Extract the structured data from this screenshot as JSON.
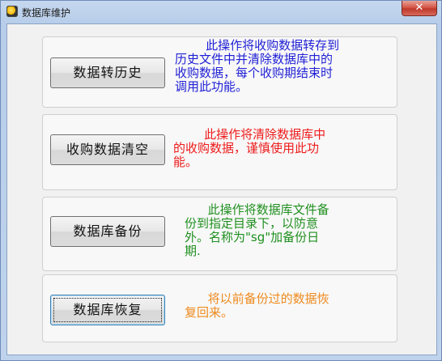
{
  "window": {
    "title": "数据库维护",
    "close_label": "✕"
  },
  "colors": {
    "panel1_text": "#1f1fd6",
    "panel2_text": "#ee1b1b",
    "panel3_text": "#1f8f1f",
    "panel4_text": "#ee8a1e"
  },
  "panels": [
    {
      "button_label": "数据转历史",
      "description": "        此操作将收购数据转存到\n历史文件中并清除数据库中的\n收购数据，每个收购期结束时\n调用此功能。"
    },
    {
      "button_label": "收购数据清空",
      "description": "        此操作将清除数据库中\n的收购数据，谨慎使用此功\n能。"
    },
    {
      "button_label": "数据库备份",
      "description": "      此操作将数据库文件备\n份到指定目录下，以防意\n外。名称为\"sg\"加备份日\n期."
    },
    {
      "button_label": "数据库恢复",
      "description": "      将以前备份过的数据恢\n复回来。"
    }
  ]
}
